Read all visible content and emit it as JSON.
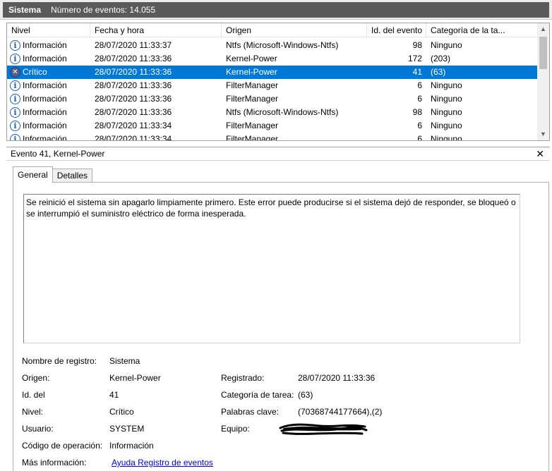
{
  "window": {
    "log_name": "Sistema",
    "event_count": "Número de eventos: 14.055"
  },
  "columns": [
    "Nivel",
    "Fecha y hora",
    "Origen",
    "Id. del evento",
    "Categoría de la ta..."
  ],
  "rows": [
    {
      "level": "Información",
      "icon": "info-icon",
      "date": "28/07/2020 11:33:37",
      "source": "Ntfs (Microsoft-Windows-Ntfs)",
      "id": "98",
      "category": "Ninguno",
      "selected": false
    },
    {
      "level": "Información",
      "icon": "info-icon",
      "date": "28/07/2020 11:33:36",
      "source": "Kernel-Power",
      "id": "172",
      "category": "(203)",
      "selected": false
    },
    {
      "level": "Crítico",
      "icon": "critical-icon",
      "date": "28/07/2020 11:33:36",
      "source": "Kernel-Power",
      "id": "41",
      "category": "(63)",
      "selected": true
    },
    {
      "level": "Información",
      "icon": "info-icon",
      "date": "28/07/2020 11:33:36",
      "source": "FilterManager",
      "id": "6",
      "category": "Ninguno",
      "selected": false
    },
    {
      "level": "Información",
      "icon": "info-icon",
      "date": "28/07/2020 11:33:36",
      "source": "FilterManager",
      "id": "6",
      "category": "Ninguno",
      "selected": false
    },
    {
      "level": "Información",
      "icon": "info-icon",
      "date": "28/07/2020 11:33:36",
      "source": "Ntfs (Microsoft-Windows-Ntfs)",
      "id": "98",
      "category": "Ninguno",
      "selected": false
    },
    {
      "level": "Información",
      "icon": "info-icon",
      "date": "28/07/2020 11:33:34",
      "source": "FilterManager",
      "id": "6",
      "category": "Ninguno",
      "selected": false
    },
    {
      "level": "Información",
      "icon": "info-icon",
      "date": "28/07/2020 11:33:34",
      "source": "FilterManager",
      "id": "6",
      "category": "Ninguno",
      "selected": false
    }
  ],
  "detail": {
    "title": "Evento 41, Kernel-Power",
    "close_symbol": "✕",
    "tabs": [
      "General",
      "Detalles"
    ],
    "description": "Se reinició el sistema sin apagarlo limpiamente primero. Este error puede producirse si el sistema dejó de responder, se bloqueó o se interrumpió el suministro eléctrico de forma inesperada.",
    "properties": {
      "log_name_label": "Nombre de registro:",
      "log_name_value": "Sistema",
      "source_label": "Origen:",
      "source_value": "Kernel-Power",
      "logged_label": "Registrado:",
      "logged_value": "28/07/2020 11:33:36",
      "id_label": "Id. del",
      "id_value": "41",
      "task_label": "Categoría de tarea:",
      "task_value": "(63)",
      "level_label": "Nivel:",
      "level_value": "Crítico",
      "keywords_label": "Palabras clave:",
      "keywords_value": "(70368744177664),(2)",
      "user_label": "Usuario:",
      "user_value": "SYSTEM",
      "computer_label": "Equipo:",
      "opcode_label": "Código de operación:",
      "opcode_value": "Información",
      "more_label": "Más información:",
      "more_link": "Ayuda Registro de eventos"
    }
  },
  "colors": {
    "selection": "#0078d7",
    "link": "#0000ee",
    "titlebar": "#5a5a5a"
  }
}
